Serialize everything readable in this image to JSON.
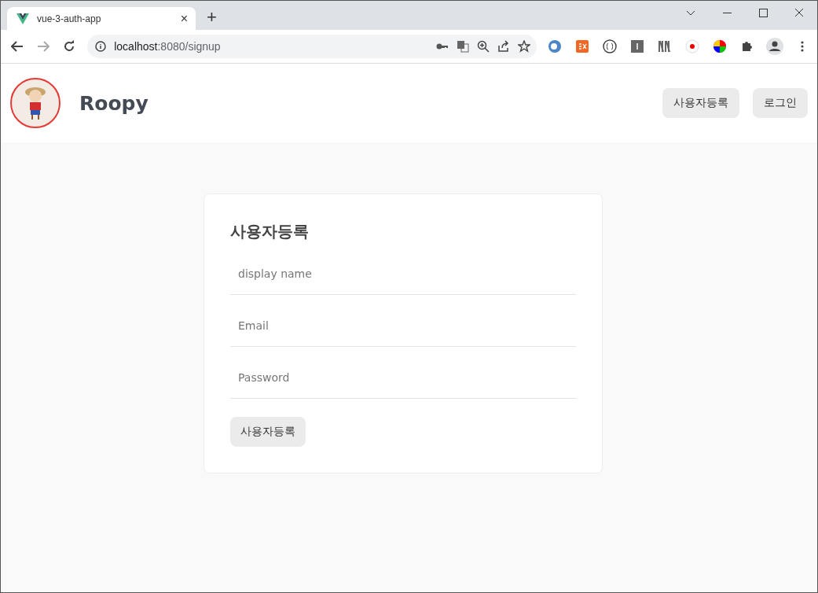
{
  "browser": {
    "tab_title": "vue-3-auth-app",
    "tab_close": "×",
    "new_tab": "+",
    "url_host": "localhost",
    "url_path": ":8080/signup"
  },
  "header": {
    "brand": "Roopy",
    "nav": [
      {
        "label": "사용자등록"
      },
      {
        "label": "로그인"
      }
    ]
  },
  "form": {
    "title": "사용자등록",
    "fields": [
      {
        "placeholder": "display name"
      },
      {
        "placeholder": "Email"
      },
      {
        "placeholder": "Password"
      }
    ],
    "submit": "사용자등록"
  }
}
